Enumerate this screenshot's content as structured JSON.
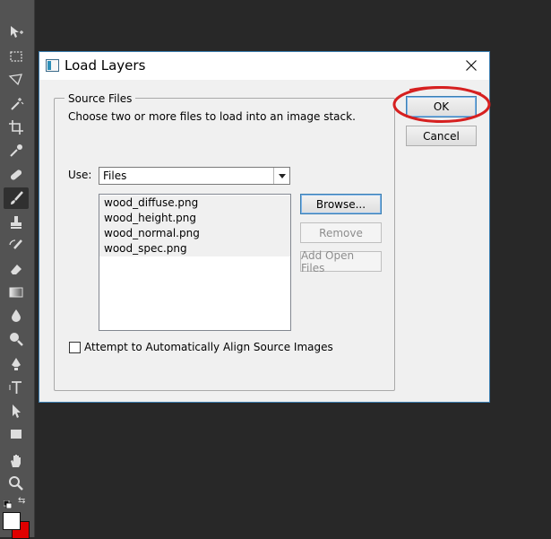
{
  "dialog": {
    "title": "Load Layers",
    "close_glyph": "✕",
    "group_label": "Source Files",
    "description": "Choose two or more files to load into an image stack.",
    "use_label": "Use:",
    "use_value": "Files",
    "files": [
      "wood_diffuse.png",
      "wood_height.png",
      "wood_normal.png",
      "wood_spec.png"
    ],
    "browse_label": "Browse...",
    "remove_label": "Remove",
    "add_open_label": "Add Open Files",
    "ok_label": "OK",
    "cancel_label": "Cancel",
    "align_label": "Attempt to Automatically Align Source Images",
    "align_checked": false
  },
  "highlight": {
    "color": "#d62020",
    "target": "ok-button"
  },
  "toolbar": {
    "icons": [
      "move-icon",
      "marquee-icon",
      "lasso-icon",
      "magic-wand-icon",
      "crop-icon",
      "eyedropper-icon",
      "healing-brush-icon",
      "brush-icon",
      "clone-stamp-icon",
      "history-brush-icon",
      "eraser-icon",
      "gradient-icon",
      "blur-icon",
      "dodge-icon",
      "pen-icon",
      "type-icon",
      "path-selection-icon",
      "rectangle-icon",
      "hand-icon",
      "zoom-icon"
    ],
    "foreground_color": "#ffffff",
    "background_color": "#e00000"
  }
}
